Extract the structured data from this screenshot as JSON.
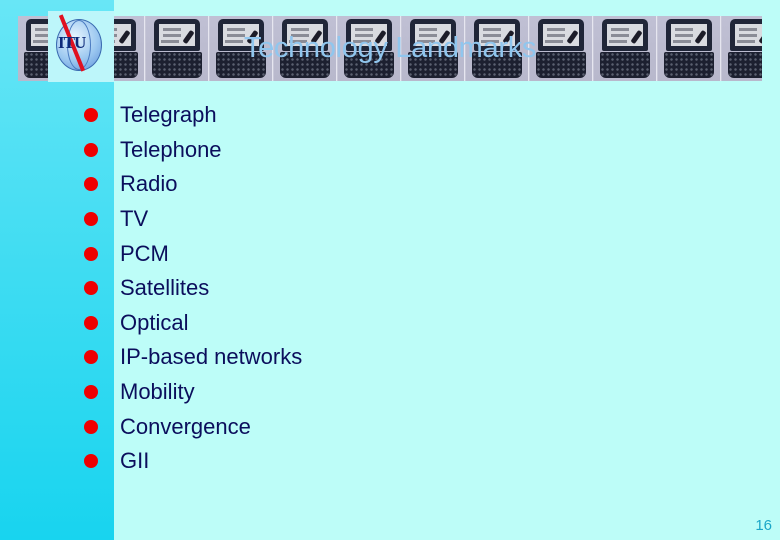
{
  "slide": {
    "title": "Technology Landmarks",
    "logo_text": "ITU",
    "banner_tiles": 13,
    "bullets": [
      "Telegraph",
      "Telephone",
      "Radio",
      "TV",
      "PCM",
      "Satellites",
      "Optical",
      "IP-based networks",
      "Mobility",
      "Convergence",
      "GII"
    ],
    "page_number": "16",
    "colors": {
      "background": "#bdfdf8",
      "sidebar": "#3fdcf2",
      "title": "#90c6ee",
      "bullet": "#ee0000",
      "text": "#0b0e5c",
      "page_number": "#1aa6c8"
    },
    "icons": {
      "banner_tile": "handheld-device-icon",
      "logo": "itu-globe-logo-icon",
      "bullet": "red-dot-icon"
    }
  }
}
